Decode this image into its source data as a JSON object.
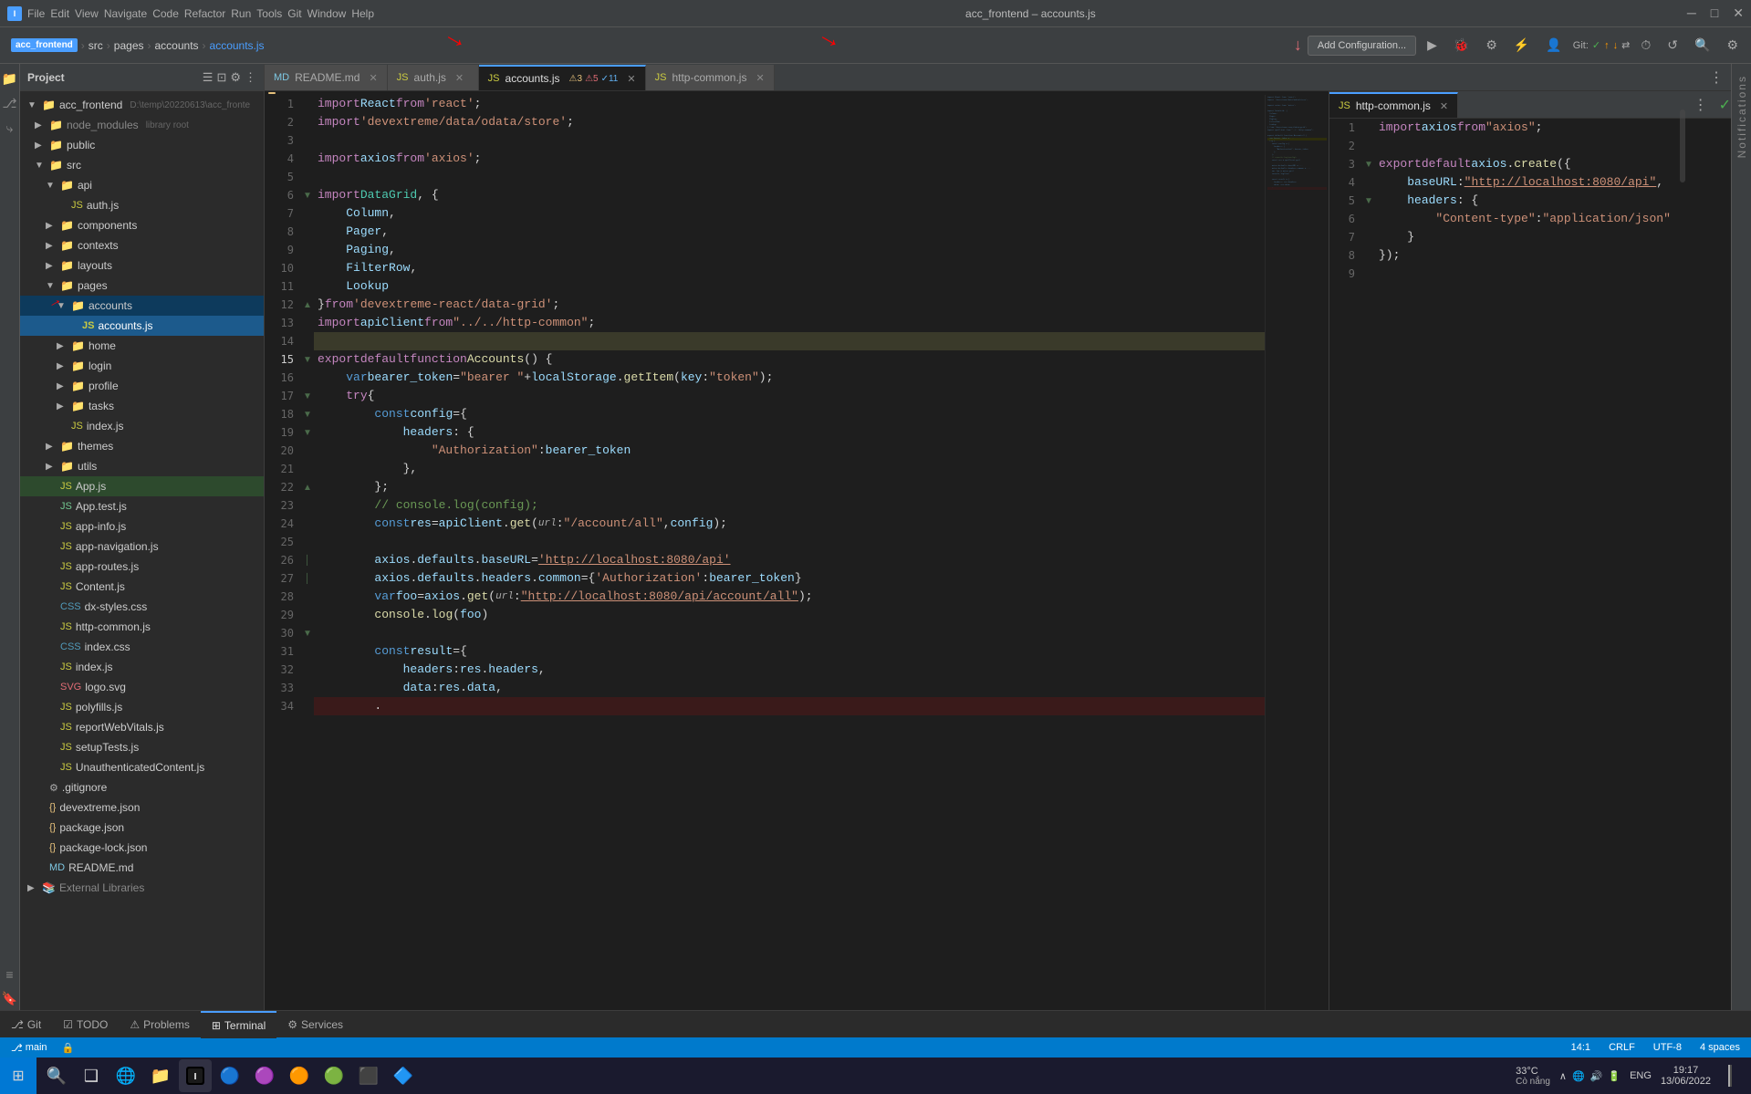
{
  "titlebar": {
    "app_name": "acc_frontend",
    "file_name": "accounts.js",
    "title": "acc_frontend – accounts.js",
    "minimize": "─",
    "maximize": "□",
    "close": "✕"
  },
  "breadcrumb": {
    "parts": [
      "src",
      "pages",
      "accounts",
      "accounts.js"
    ]
  },
  "toolbar": {
    "menus": [
      "File",
      "Edit",
      "View",
      "Navigate",
      "Code",
      "Refactor",
      "Run",
      "Tools",
      "Git",
      "Window",
      "Help"
    ],
    "add_config_label": "Add Configuration...",
    "git_label": "Git:",
    "run_icon": "▶",
    "profile_icon": "👤"
  },
  "sidebar": {
    "project_label": "Project",
    "root_label": "acc_frontend",
    "root_path": "D:\\temp\\20220613\\acc_fronte",
    "items": [
      {
        "id": "node_modules",
        "label": "node_modules",
        "type": "folder",
        "indent": 1,
        "expanded": false,
        "dim": true
      },
      {
        "id": "public",
        "label": "public",
        "type": "folder",
        "indent": 1,
        "expanded": false
      },
      {
        "id": "src",
        "label": "src",
        "type": "folder",
        "indent": 1,
        "expanded": true
      },
      {
        "id": "api",
        "label": "api",
        "type": "folder",
        "indent": 2,
        "expanded": true
      },
      {
        "id": "auth.js",
        "label": "auth.js",
        "type": "file-js",
        "indent": 3
      },
      {
        "id": "components",
        "label": "components",
        "type": "folder",
        "indent": 2,
        "expanded": false
      },
      {
        "id": "contexts",
        "label": "contexts",
        "type": "folder",
        "indent": 2,
        "expanded": false
      },
      {
        "id": "layouts",
        "label": "layouts",
        "type": "folder",
        "indent": 2,
        "expanded": false
      },
      {
        "id": "pages",
        "label": "pages",
        "type": "folder",
        "indent": 2,
        "expanded": true
      },
      {
        "id": "accounts",
        "label": "accounts",
        "type": "folder",
        "indent": 3,
        "expanded": true,
        "selected": true
      },
      {
        "id": "accounts.js",
        "label": "accounts.js",
        "type": "file-js",
        "indent": 4,
        "active": true
      },
      {
        "id": "home",
        "label": "home",
        "type": "folder",
        "indent": 3,
        "expanded": false
      },
      {
        "id": "login",
        "label": "login",
        "type": "folder",
        "indent": 3,
        "expanded": false
      },
      {
        "id": "profile",
        "label": "profile",
        "type": "folder",
        "indent": 3,
        "expanded": false
      },
      {
        "id": "tasks",
        "label": "tasks",
        "type": "folder",
        "indent": 3,
        "expanded": false
      },
      {
        "id": "index.js",
        "label": "index.js",
        "type": "file-js",
        "indent": 3
      },
      {
        "id": "themes",
        "label": "themes",
        "type": "folder",
        "indent": 2,
        "expanded": false
      },
      {
        "id": "utils",
        "label": "utils",
        "type": "folder",
        "indent": 2,
        "expanded": false
      },
      {
        "id": "App.js",
        "label": "App.js",
        "type": "file-js",
        "indent": 2
      },
      {
        "id": "App.test.js",
        "label": "App.test.js",
        "type": "file-test",
        "indent": 2
      },
      {
        "id": "app-info.js",
        "label": "app-info.js",
        "type": "file-js",
        "indent": 2
      },
      {
        "id": "app-navigation.js",
        "label": "app-navigation.js",
        "type": "file-js",
        "indent": 2
      },
      {
        "id": "app-routes.js",
        "label": "app-routes.js",
        "type": "file-js",
        "indent": 2
      },
      {
        "id": "Content.js",
        "label": "Content.js",
        "type": "file-js",
        "indent": 2
      },
      {
        "id": "dx-styles.css",
        "label": "dx-styles.css",
        "type": "file-css",
        "indent": 2
      },
      {
        "id": "http-common.js",
        "label": "http-common.js",
        "type": "file-js",
        "indent": 2
      },
      {
        "id": "index.css",
        "label": "index.css",
        "type": "file-css",
        "indent": 2
      },
      {
        "id": "index.js2",
        "label": "index.js",
        "type": "file-js",
        "indent": 2
      },
      {
        "id": "logo.svg",
        "label": "logo.svg",
        "type": "file-svg",
        "indent": 2
      },
      {
        "id": "polyfills.js",
        "label": "polyfills.js",
        "type": "file-js",
        "indent": 2
      },
      {
        "id": "reportWebVitals.js",
        "label": "reportWebVitals.js",
        "type": "file-js",
        "indent": 2
      },
      {
        "id": "setupTests.js",
        "label": "setupTests.js",
        "type": "file-js",
        "indent": 2
      },
      {
        "id": "UnauthenticatedContent.js",
        "label": "UnauthenticatedContent.js",
        "type": "file-js",
        "indent": 2
      },
      {
        "id": "gitignore",
        "label": ".gitignore",
        "type": "file-md",
        "indent": 1
      },
      {
        "id": "devextreme.json",
        "label": "devextreme.json",
        "type": "file-json",
        "indent": 1
      },
      {
        "id": "package.json",
        "label": "package.json",
        "type": "file-json",
        "indent": 1
      },
      {
        "id": "package-lock.json",
        "label": "package-lock.json",
        "type": "file-json",
        "indent": 1
      },
      {
        "id": "README.md",
        "label": "README.md",
        "type": "file-md",
        "indent": 1
      },
      {
        "id": "External Libraries",
        "label": "External Libraries",
        "type": "folder",
        "indent": 0,
        "expanded": false
      }
    ]
  },
  "tabs": {
    "left": [
      {
        "id": "README.md",
        "label": "README.md",
        "type": "file-md",
        "active": false
      },
      {
        "id": "auth.js",
        "label": "auth.js",
        "type": "file-js",
        "active": false
      },
      {
        "id": "accounts.js",
        "label": "accounts.js",
        "type": "file-js",
        "active": true
      },
      {
        "id": "http-common.js-left",
        "label": "http-common.js",
        "type": "file-js",
        "active": false
      }
    ],
    "right": [
      {
        "id": "http-common.js-right",
        "label": "http-common.js",
        "type": "file-js",
        "active": true
      }
    ]
  },
  "left_editor": {
    "filename": "accounts.js",
    "warnings": "3",
    "errors": "5",
    "info": "11",
    "lines": [
      {
        "n": 1,
        "code": "import React from 'react';"
      },
      {
        "n": 2,
        "code": "import 'devextreme/data/odata/store';"
      },
      {
        "n": 3,
        "code": ""
      },
      {
        "n": 4,
        "code": "import axios from 'axios';"
      },
      {
        "n": 5,
        "code": ""
      },
      {
        "n": 6,
        "code": "import DataGrid, {"
      },
      {
        "n": 7,
        "code": "    Column,"
      },
      {
        "n": 8,
        "code": "    Pager,"
      },
      {
        "n": 9,
        "code": "    Paging,"
      },
      {
        "n": 10,
        "code": "    FilterRow,"
      },
      {
        "n": 11,
        "code": "    Lookup"
      },
      {
        "n": 12,
        "code": "} from 'devextreme-react/data-grid';"
      },
      {
        "n": 13,
        "code": "import apiClient from \"../../http-common\";"
      },
      {
        "n": 14,
        "code": ""
      },
      {
        "n": 15,
        "code": "export default function Accounts() {"
      },
      {
        "n": 16,
        "code": "    var bearer_token = \"bearer \" + localStorage.getItem( key: \"token\");"
      },
      {
        "n": 17,
        "code": "    try {"
      },
      {
        "n": 18,
        "code": "        const config = {"
      },
      {
        "n": 19,
        "code": "            headers: {"
      },
      {
        "n": 20,
        "code": "                \"Authorization\": bearer_token"
      },
      {
        "n": 21,
        "code": "            },"
      },
      {
        "n": 22,
        "code": "        };"
      },
      {
        "n": 23,
        "code": "        // console.log(config);"
      },
      {
        "n": 24,
        "code": "        const res = apiClient.get( url: \"/account/all\", config);"
      },
      {
        "n": 25,
        "code": ""
      },
      {
        "n": 26,
        "code": "        axios.defaults.baseURL = 'http://localhost:8080/api'"
      },
      {
        "n": 27,
        "code": "        axios.defaults.headers.common = {'Authorization': bearer_token}"
      },
      {
        "n": 28,
        "code": "        var foo = axios.get( url: \"http://localhost:8080/api/account/all\");"
      },
      {
        "n": 29,
        "code": "        console.log(foo)"
      },
      {
        "n": 30,
        "code": ""
      },
      {
        "n": 31,
        "code": "        const result = {"
      },
      {
        "n": 32,
        "code": "            headers: res.headers,"
      },
      {
        "n": 33,
        "code": "            data: res.data,"
      },
      {
        "n": 34,
        "code": "        ."
      }
    ]
  },
  "right_editor": {
    "filename": "http-common.js",
    "lines": [
      {
        "n": 1,
        "code": "import axios from \"axios\";"
      },
      {
        "n": 2,
        "code": ""
      },
      {
        "n": 3,
        "code": "export default axios.create({"
      },
      {
        "n": 4,
        "code": "    baseURL: \"http://localhost:8080/api\","
      },
      {
        "n": 5,
        "code": "    headers: {"
      },
      {
        "n": 6,
        "code": "        \"Content-type\": \"application/json\""
      },
      {
        "n": 7,
        "code": "    }"
      },
      {
        "n": 8,
        "code": "});"
      },
      {
        "n": 9,
        "code": ""
      }
    ]
  },
  "bottom_panel": {
    "tabs": [
      {
        "id": "git",
        "label": "Git",
        "icon": "⎇",
        "active": false
      },
      {
        "id": "todo",
        "label": "TODO",
        "icon": "☑",
        "active": false
      },
      {
        "id": "problems",
        "label": "Problems",
        "icon": "⚠",
        "active": false
      },
      {
        "id": "terminal",
        "label": "Terminal",
        "icon": "⊞",
        "active": false
      },
      {
        "id": "services",
        "label": "Services",
        "icon": "⚙",
        "active": false
      }
    ]
  },
  "status_bar": {
    "position": "14:1",
    "line_ending": "CRLF",
    "encoding": "UTF-8",
    "indent": "4 spaces",
    "branch": "main",
    "lock_icon": "🔒",
    "temperature": "33°C",
    "weather": "Cò nắng",
    "time": "19:17",
    "date": "13/06/2022",
    "language": "ENG"
  },
  "left_panel_icons": [
    {
      "id": "explorer",
      "icon": "📁",
      "active": true
    },
    {
      "id": "search",
      "icon": "🔍"
    },
    {
      "id": "git",
      "icon": "⎇"
    },
    {
      "id": "run",
      "icon": "▶"
    },
    {
      "id": "extensions",
      "icon": "⊞"
    }
  ],
  "taskbar": {
    "start_icon": "⊞",
    "apps": [
      {
        "id": "search",
        "icon": "🔍"
      },
      {
        "id": "taskview",
        "icon": "❑"
      },
      {
        "id": "edge",
        "icon": "🌐"
      },
      {
        "id": "explorer",
        "icon": "📁"
      },
      {
        "id": "intellij",
        "icon": "🔷"
      },
      {
        "id": "app6",
        "icon": "🔴"
      },
      {
        "id": "app7",
        "icon": "🟤"
      },
      {
        "id": "app8",
        "icon": "🟠"
      },
      {
        "id": "app9",
        "icon": "🟢"
      },
      {
        "id": "app10",
        "icon": "🔵"
      },
      {
        "id": "app11",
        "icon": "⬛"
      }
    ]
  }
}
